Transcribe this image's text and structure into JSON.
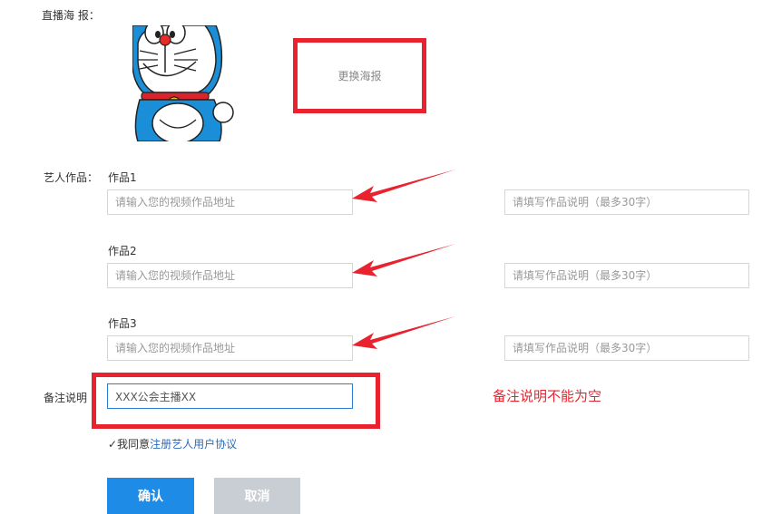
{
  "poster": {
    "label": "直播海 报：",
    "change_text": "更换海报"
  },
  "works": {
    "section_label": "艺人作品：",
    "items": [
      {
        "title": "作品1",
        "url_placeholder": "请输入您的视频作品地址",
        "desc_placeholder": "请填写作品说明（最多30字）"
      },
      {
        "title": "作品2",
        "url_placeholder": "请输入您的视频作品地址",
        "desc_placeholder": "请填写作品说明（最多30字）"
      },
      {
        "title": "作品3",
        "url_placeholder": "请输入您的视频作品地址",
        "desc_placeholder": "请填写作品说明（最多30字）"
      }
    ]
  },
  "remark": {
    "label": "备注说明",
    "value": "XXX公会主播XX",
    "error": "备注说明不能为空"
  },
  "agreement": {
    "prefix": "✓我同意",
    "link": "注册艺人用户协议"
  },
  "buttons": {
    "confirm": "确认",
    "cancel": "取消"
  },
  "colors": {
    "annotation_red": "#e8232f",
    "primary_blue": "#1e8ce6",
    "link_blue": "#2d6bb8",
    "disabled_gray": "#c9ced4"
  }
}
